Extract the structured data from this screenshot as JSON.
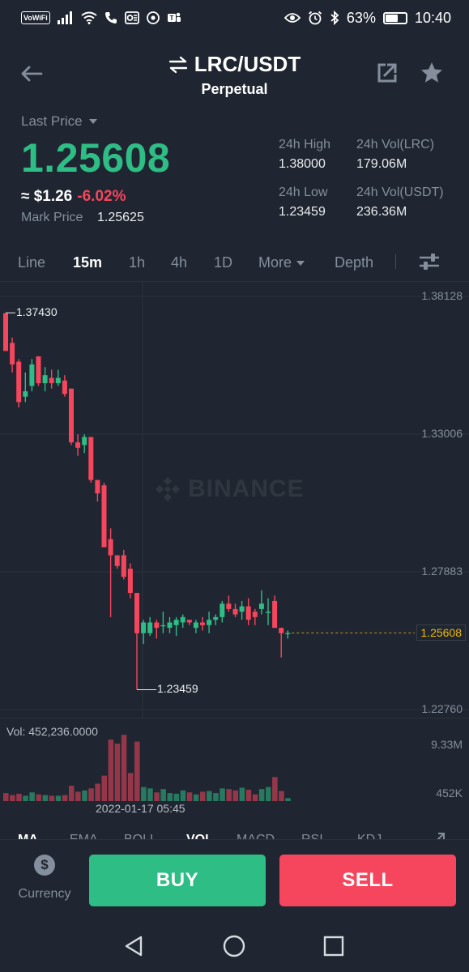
{
  "status_bar": {
    "carrier_badge": "VoWiFi",
    "battery": "63%",
    "battery_level": 0.63,
    "time": "10:40"
  },
  "header": {
    "pair": "LRC/USDT",
    "contract_type": "Perpetual"
  },
  "price": {
    "last_price_label": "Last Price",
    "last_price": "1.25608",
    "approx_usd": "≈ $1.26",
    "change": "-6.02%",
    "mark_price_label": "Mark Price",
    "mark_price": "1.25625"
  },
  "stats": {
    "high_label": "24h High",
    "high_value": "1.38000",
    "vol_base_label": "24h Vol(LRC)",
    "vol_base_value": "179.06M",
    "low_label": "24h Low",
    "low_value": "1.23459",
    "vol_quote_label": "24h Vol(USDT)",
    "vol_quote_value": "236.36M"
  },
  "timeframes": {
    "line": "Line",
    "m15": "15m",
    "h1": "1h",
    "h4": "4h",
    "d1": "1D",
    "more": "More",
    "depth": "Depth",
    "active": "15m"
  },
  "chart": {
    "watermark": "BINANCE",
    "axis_labels": [
      "1.38128",
      "1.33006",
      "1.27883",
      "1.22760"
    ],
    "last_price_tag": "1.25608",
    "high_annotation": "1.37430",
    "low_annotation": "1.23459",
    "up_color": "#2ebd85",
    "down_color": "#f6465d",
    "last_line_color": "#f0b90b"
  },
  "volume": {
    "label": "Vol: 452,236.0000",
    "max_label": "9.33M",
    "min_label": "452K",
    "time_label": "2022-01-17 05:45"
  },
  "indicators": {
    "ma": "MA",
    "ema": "EMA",
    "boll": "BOLL",
    "vol": "VOL",
    "macd": "MACD",
    "rsi": "RSI",
    "kdj": "KDJ"
  },
  "actions": {
    "currency_label": "Currency",
    "buy": "BUY",
    "sell": "SELL"
  },
  "chart_data": {
    "type": "candlestick",
    "interval": "15m",
    "ylim": [
      1.2276,
      1.38128
    ],
    "candles": [
      {
        "o": 1.375,
        "h": 1.3752,
        "l": 1.361,
        "c": 1.361
      },
      {
        "o": 1.364,
        "h": 1.366,
        "l": 1.353,
        "c": 1.356
      },
      {
        "o": 1.357,
        "h": 1.358,
        "l": 1.34,
        "c": 1.342
      },
      {
        "o": 1.344,
        "h": 1.353,
        "l": 1.342,
        "c": 1.346
      },
      {
        "o": 1.348,
        "h": 1.358,
        "l": 1.346,
        "c": 1.356
      },
      {
        "o": 1.359,
        "h": 1.359,
        "l": 1.348,
        "c": 1.349
      },
      {
        "o": 1.349,
        "h": 1.355,
        "l": 1.346,
        "c": 1.352
      },
      {
        "o": 1.351,
        "h": 1.354,
        "l": 1.347,
        "c": 1.349
      },
      {
        "o": 1.349,
        "h": 1.354,
        "l": 1.348,
        "c": 1.351
      },
      {
        "o": 1.35,
        "h": 1.352,
        "l": 1.344,
        "c": 1.345
      },
      {
        "o": 1.347,
        "h": 1.347,
        "l": 1.326,
        "c": 1.327
      },
      {
        "o": 1.327,
        "h": 1.33,
        "l": 1.322,
        "c": 1.325
      },
      {
        "o": 1.326,
        "h": 1.33,
        "l": 1.323,
        "c": 1.329
      },
      {
        "o": 1.329,
        "h": 1.329,
        "l": 1.312,
        "c": 1.313
      },
      {
        "o": 1.313,
        "h": 1.313,
        "l": 1.305,
        "c": 1.308
      },
      {
        "o": 1.311,
        "h": 1.312,
        "l": 1.288,
        "c": 1.288
      },
      {
        "o": 1.291,
        "h": 1.295,
        "l": 1.262,
        "c": 1.285
      },
      {
        "o": 1.285,
        "h": 1.285,
        "l": 1.28,
        "c": 1.281
      },
      {
        "o": 1.285,
        "h": 1.287,
        "l": 1.276,
        "c": 1.277
      },
      {
        "o": 1.28,
        "h": 1.282,
        "l": 1.269,
        "c": 1.271
      },
      {
        "o": 1.271,
        "h": 1.271,
        "l": 1.235,
        "c": 1.256
      },
      {
        "o": 1.256,
        "h": 1.261,
        "l": 1.252,
        "c": 1.26
      },
      {
        "o": 1.256,
        "h": 1.262,
        "l": 1.255,
        "c": 1.26
      },
      {
        "o": 1.26,
        "h": 1.261,
        "l": 1.254,
        "c": 1.258
      },
      {
        "o": 1.259,
        "h": 1.264,
        "l": 1.256,
        "c": 1.259
      },
      {
        "o": 1.258,
        "h": 1.262,
        "l": 1.256,
        "c": 1.26
      },
      {
        "o": 1.259,
        "h": 1.262,
        "l": 1.255,
        "c": 1.261
      },
      {
        "o": 1.26,
        "h": 1.263,
        "l": 1.258,
        "c": 1.262
      },
      {
        "o": 1.261,
        "h": 1.261,
        "l": 1.259,
        "c": 1.26
      },
      {
        "o": 1.258,
        "h": 1.261,
        "l": 1.256,
        "c": 1.26
      },
      {
        "o": 1.26,
        "h": 1.262,
        "l": 1.257,
        "c": 1.259
      },
      {
        "o": 1.259,
        "h": 1.264,
        "l": 1.256,
        "c": 1.261
      },
      {
        "o": 1.261,
        "h": 1.263,
        "l": 1.259,
        "c": 1.262
      },
      {
        "o": 1.262,
        "h": 1.268,
        "l": 1.26,
        "c": 1.267
      },
      {
        "o": 1.267,
        "h": 1.27,
        "l": 1.264,
        "c": 1.265
      },
      {
        "o": 1.265,
        "h": 1.267,
        "l": 1.262,
        "c": 1.263
      },
      {
        "o": 1.264,
        "h": 1.268,
        "l": 1.261,
        "c": 1.266
      },
      {
        "o": 1.266,
        "h": 1.269,
        "l": 1.259,
        "c": 1.261
      },
      {
        "o": 1.264,
        "h": 1.265,
        "l": 1.259,
        "c": 1.262
      },
      {
        "o": 1.265,
        "h": 1.272,
        "l": 1.263,
        "c": 1.267
      },
      {
        "o": 1.264,
        "h": 1.269,
        "l": 1.259,
        "c": 1.264
      },
      {
        "o": 1.268,
        "h": 1.27,
        "l": 1.258,
        "c": 1.258
      },
      {
        "o": 1.258,
        "h": 1.258,
        "l": 1.247,
        "c": 1.256
      },
      {
        "o": 1.256,
        "h": 1.257,
        "l": 1.254,
        "c": 1.2561
      }
    ],
    "volume_ylim": [
      452000,
      9330000
    ],
    "volumes": [
      1.2,
      0.9,
      1.1,
      0.8,
      1.3,
      1.0,
      0.9,
      0.8,
      0.8,
      0.9,
      2.3,
      1.4,
      1.6,
      1.9,
      2.6,
      3.8,
      9.2,
      8.6,
      9.9,
      4.2,
      8.9,
      2.1,
      1.9,
      1.3,
      1.8,
      1.2,
      1.1,
      1.6,
      1.3,
      1.0,
      1.4,
      1.5,
      1.2,
      1.9,
      1.8,
      1.6,
      2.0,
      1.7,
      1.0,
      1.8,
      2.1,
      3.6,
      1.5,
      0.45
    ]
  }
}
